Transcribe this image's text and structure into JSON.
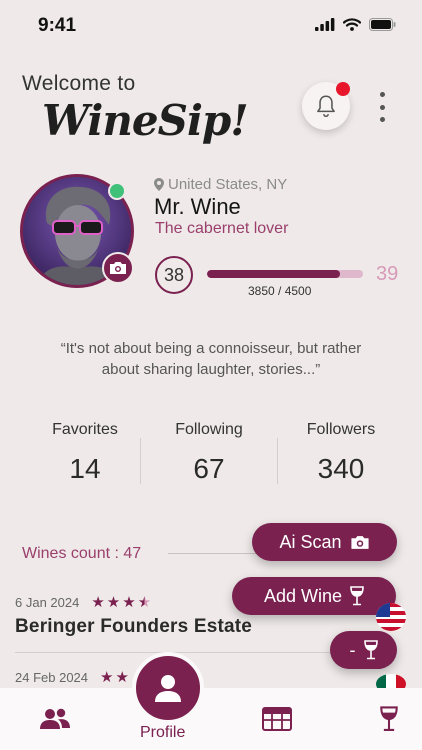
{
  "status_bar": {
    "time": "9:41"
  },
  "header": {
    "welcome": "Welcome to",
    "brand": "WineSip!"
  },
  "profile": {
    "location": "United States, NY",
    "name": "Mr. Wine",
    "tagline": "The cabernet lover",
    "level": "38",
    "next_level": "39",
    "xp_text": "3850 / 4500",
    "xp_fraction": 0.8556,
    "quote": "“It's not about being a connoisseur, but rather about sharing laughter, stories...”"
  },
  "stats": [
    {
      "label": "Favorites",
      "value": "14"
    },
    {
      "label": "Following",
      "value": "67"
    },
    {
      "label": "Followers",
      "value": "340"
    }
  ],
  "wines": {
    "count_label": "Wines count : 47",
    "items": [
      {
        "date": "6 Jan 2024",
        "name": "Beringer Founders Estate",
        "rating": 3.5
      },
      {
        "date": "24 Feb 2024",
        "name": "",
        "rating": 2
      }
    ]
  },
  "actions": {
    "ai_scan": "Ai Scan",
    "add_wine": "Add Wine",
    "minus": "-"
  },
  "nav": {
    "profile_label": "Profile"
  },
  "colors": {
    "accent": "#7a2150",
    "accent_light": "#9a3f6c",
    "online": "#3fc17a",
    "notification": "#e8162a"
  },
  "icons": [
    "signal-icon",
    "wifi-icon",
    "battery-icon",
    "bell-icon",
    "more-vertical-icon",
    "location-pin-icon",
    "camera-icon",
    "star-icon",
    "wine-glass-icon",
    "us-flag-icon",
    "mexico-flag-icon",
    "friends-icon",
    "profile-icon",
    "wine-list-icon"
  ]
}
